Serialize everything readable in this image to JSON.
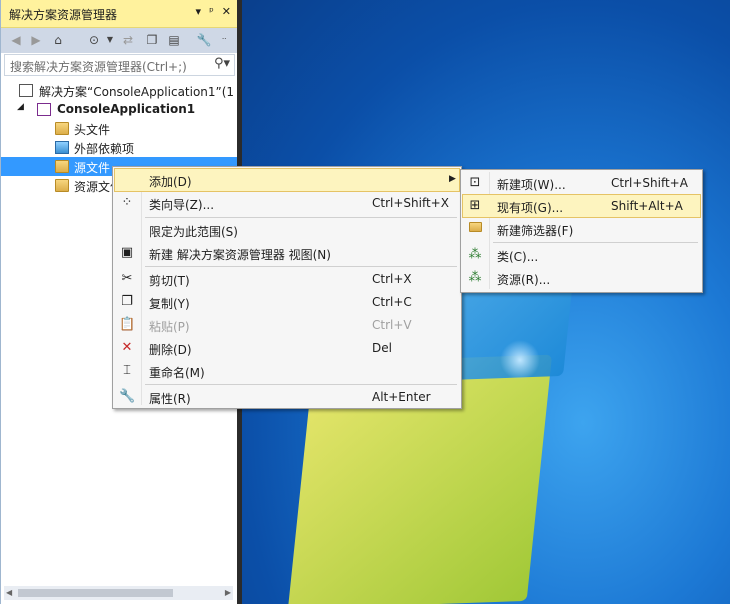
{
  "panel": {
    "title": "解决方案资源管理器",
    "title_buttons": [
      "▾",
      "ᵖ",
      "✕"
    ],
    "search_placeholder": "搜索解决方案资源管理器(Ctrl+;)"
  },
  "tree": {
    "solution": "解决方案“ConsoleApplication1”(1",
    "project": "ConsoleApplication1",
    "items": [
      {
        "label": "头文件"
      },
      {
        "label": "外部依赖项"
      },
      {
        "label": "源文件"
      },
      {
        "label": "资源文件"
      }
    ]
  },
  "context_menu": {
    "items": [
      {
        "label": "添加(D)",
        "shortcut": "",
        "icon": "none",
        "submenu": true
      },
      {
        "label": "类向导(Z)...",
        "shortcut": "Ctrl+Shift+X",
        "icon": "class-wizard-icon"
      },
      {
        "label": "限定为此范围(S)",
        "shortcut": "",
        "icon": "none"
      },
      {
        "label": "新建 解决方案资源管理器 视图(N)",
        "shortcut": "",
        "icon": "new-view-icon"
      },
      {
        "label": "剪切(T)",
        "shortcut": "Ctrl+X",
        "icon": "scissors-icon"
      },
      {
        "label": "复制(Y)",
        "shortcut": "Ctrl+C",
        "icon": "copy-icon"
      },
      {
        "label": "粘贴(P)",
        "shortcut": "Ctrl+V",
        "icon": "paste-icon",
        "disabled": true
      },
      {
        "label": "删除(D)",
        "shortcut": "Del",
        "icon": "delete-icon"
      },
      {
        "label": "重命名(M)",
        "shortcut": "",
        "icon": "rename-icon"
      },
      {
        "label": "属性(R)",
        "shortcut": "Alt+Enter",
        "icon": "wrench-icon"
      }
    ]
  },
  "submenu": {
    "items": [
      {
        "label": "新建项(W)...",
        "shortcut": "Ctrl+Shift+A"
      },
      {
        "label": "现有项(G)...",
        "shortcut": "Shift+Alt+A"
      },
      {
        "label": "新建筛选器(F)",
        "shortcut": ""
      },
      {
        "label": "类(C)...",
        "shortcut": ""
      },
      {
        "label": "资源(R)...",
        "shortcut": ""
      }
    ]
  }
}
